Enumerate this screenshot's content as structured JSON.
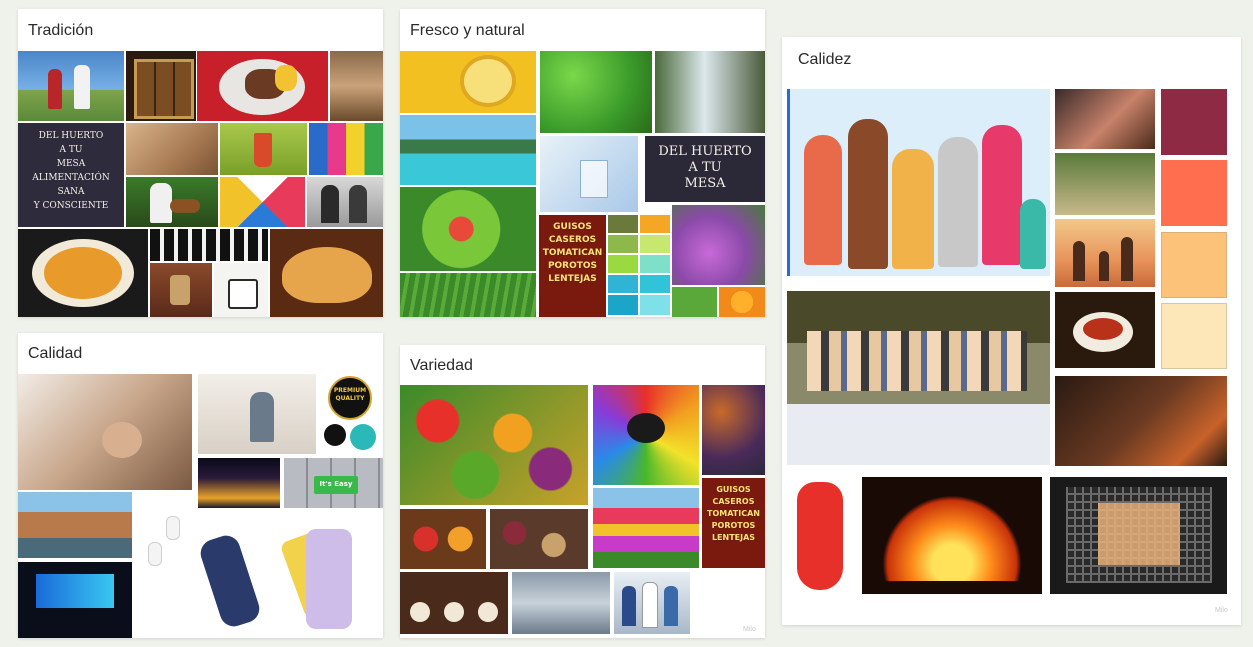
{
  "boards": {
    "tradicion": {
      "title": "Tradición"
    },
    "fresco": {
      "title": "Fresco y natural"
    },
    "calidez": {
      "title": "Calidez"
    },
    "calidad": {
      "title": "Calidad"
    },
    "variedad": {
      "title": "Variedad"
    }
  },
  "texts": {
    "chalkboard_tradicion": "DEL HUERTO\nA TU\nMESA\nALIMENTACIÓN SANA\nY CONSCIENTE",
    "chalkboard_fresco": "DEL HUERTO\nA TU\nMESA",
    "sign_fresco": "GUISOS\nCASEROS\nTOMATICAN\nPOROTOS\nLENTEJAS",
    "sign_variedad": "GUISOS\nCASEROS\nTOMATICAN\nPOROTOS\nLENTEJAS",
    "badge_premium": "PREMIUM\nQUALITY",
    "key_easy": "It's Easy"
  },
  "watermark": "Milo",
  "colors": {
    "background": "#eef2ea",
    "calidez_palette": [
      "#8e2a44",
      "#ff6f4f",
      "#fcc27a",
      "#fde6b8"
    ],
    "fresco_palette": [
      "#f5a623",
      "#8db84a",
      "#c6e86f",
      "#7ee0c9",
      "#31c4d8",
      "#1ba6c9",
      "#9ad93f",
      "#2fb4d6"
    ]
  }
}
